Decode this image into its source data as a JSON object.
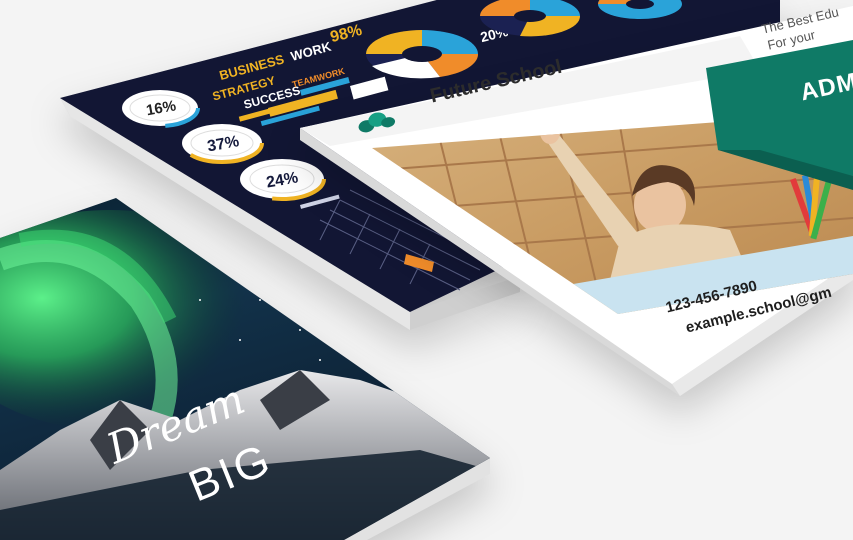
{
  "infographic": {
    "pct1": "16%",
    "pct2": "37%",
    "pct3": "24%",
    "pct4": "98%",
    "pct5": "20%",
    "words": [
      "BUSINESS",
      "WORK",
      "STRATEGY",
      "SUCCESS",
      "TEAMWORK"
    ]
  },
  "flyer": {
    "brand": "Future School",
    "tagline_1": "The Best Edu",
    "tagline_2": "For your",
    "banner": "ADM",
    "phone": "123-456-7890",
    "email": "example.school@gm"
  },
  "poster": {
    "line1": "Dream",
    "line2": "BIG"
  },
  "colors": {
    "teal": "#0f7a66",
    "navy": "#101633",
    "aurora": "#34d06e"
  }
}
